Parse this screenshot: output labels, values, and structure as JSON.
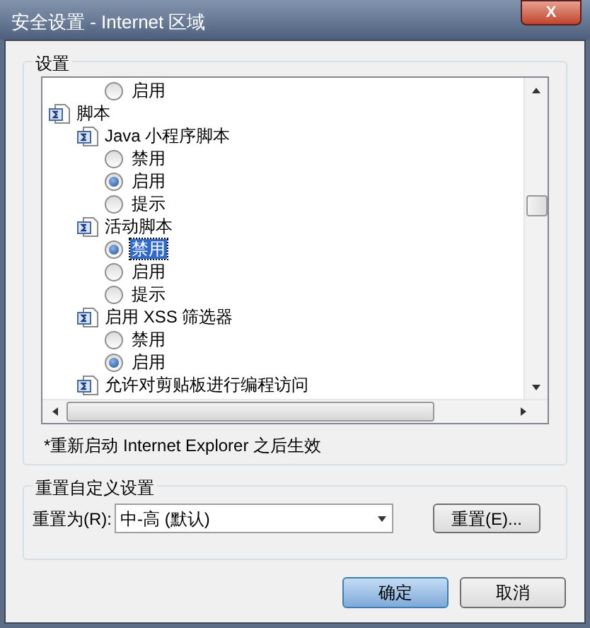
{
  "window": {
    "title": "安全设置 - Internet 区域",
    "close": "X"
  },
  "settings_group": {
    "title": "设置",
    "tree": [
      {
        "kind": "group",
        "children": [
          {
            "kind": "group",
            "children": [
              {
                "kind": "radio",
                "label": "启用",
                "selected": false,
                "highlighted": false
              }
            ]
          }
        ]
      },
      {
        "kind": "group",
        "label": "脚本",
        "children": [
          {
            "kind": "group",
            "label": "Java 小程序脚本",
            "children": [
              {
                "kind": "radio",
                "label": "禁用",
                "selected": false,
                "highlighted": false
              },
              {
                "kind": "radio",
                "label": "启用",
                "selected": true,
                "highlighted": false
              },
              {
                "kind": "radio",
                "label": "提示",
                "selected": false,
                "highlighted": false
              }
            ]
          },
          {
            "kind": "group",
            "label": "活动脚本",
            "children": [
              {
                "kind": "radio",
                "label": "禁用",
                "selected": true,
                "highlighted": true
              },
              {
                "kind": "radio",
                "label": "启用",
                "selected": false,
                "highlighted": false
              },
              {
                "kind": "radio",
                "label": "提示",
                "selected": false,
                "highlighted": false
              }
            ]
          },
          {
            "kind": "group",
            "label": "启用 XSS 筛选器",
            "children": [
              {
                "kind": "radio",
                "label": "禁用",
                "selected": false,
                "highlighted": false
              },
              {
                "kind": "radio",
                "label": "启用",
                "selected": true,
                "highlighted": false
              }
            ]
          },
          {
            "kind": "group",
            "label": "允许对剪贴板进行编程访问"
          }
        ]
      }
    ],
    "note": "*重新启动 Internet Explorer 之后生效"
  },
  "reset_group": {
    "title": "重置自定义设置",
    "label": "重置为(R):",
    "value": "中-高 (默认)",
    "button": "重置(E)..."
  },
  "buttons": [
    {
      "label": "确定",
      "default": true
    },
    {
      "label": "取消",
      "default": false
    }
  ]
}
